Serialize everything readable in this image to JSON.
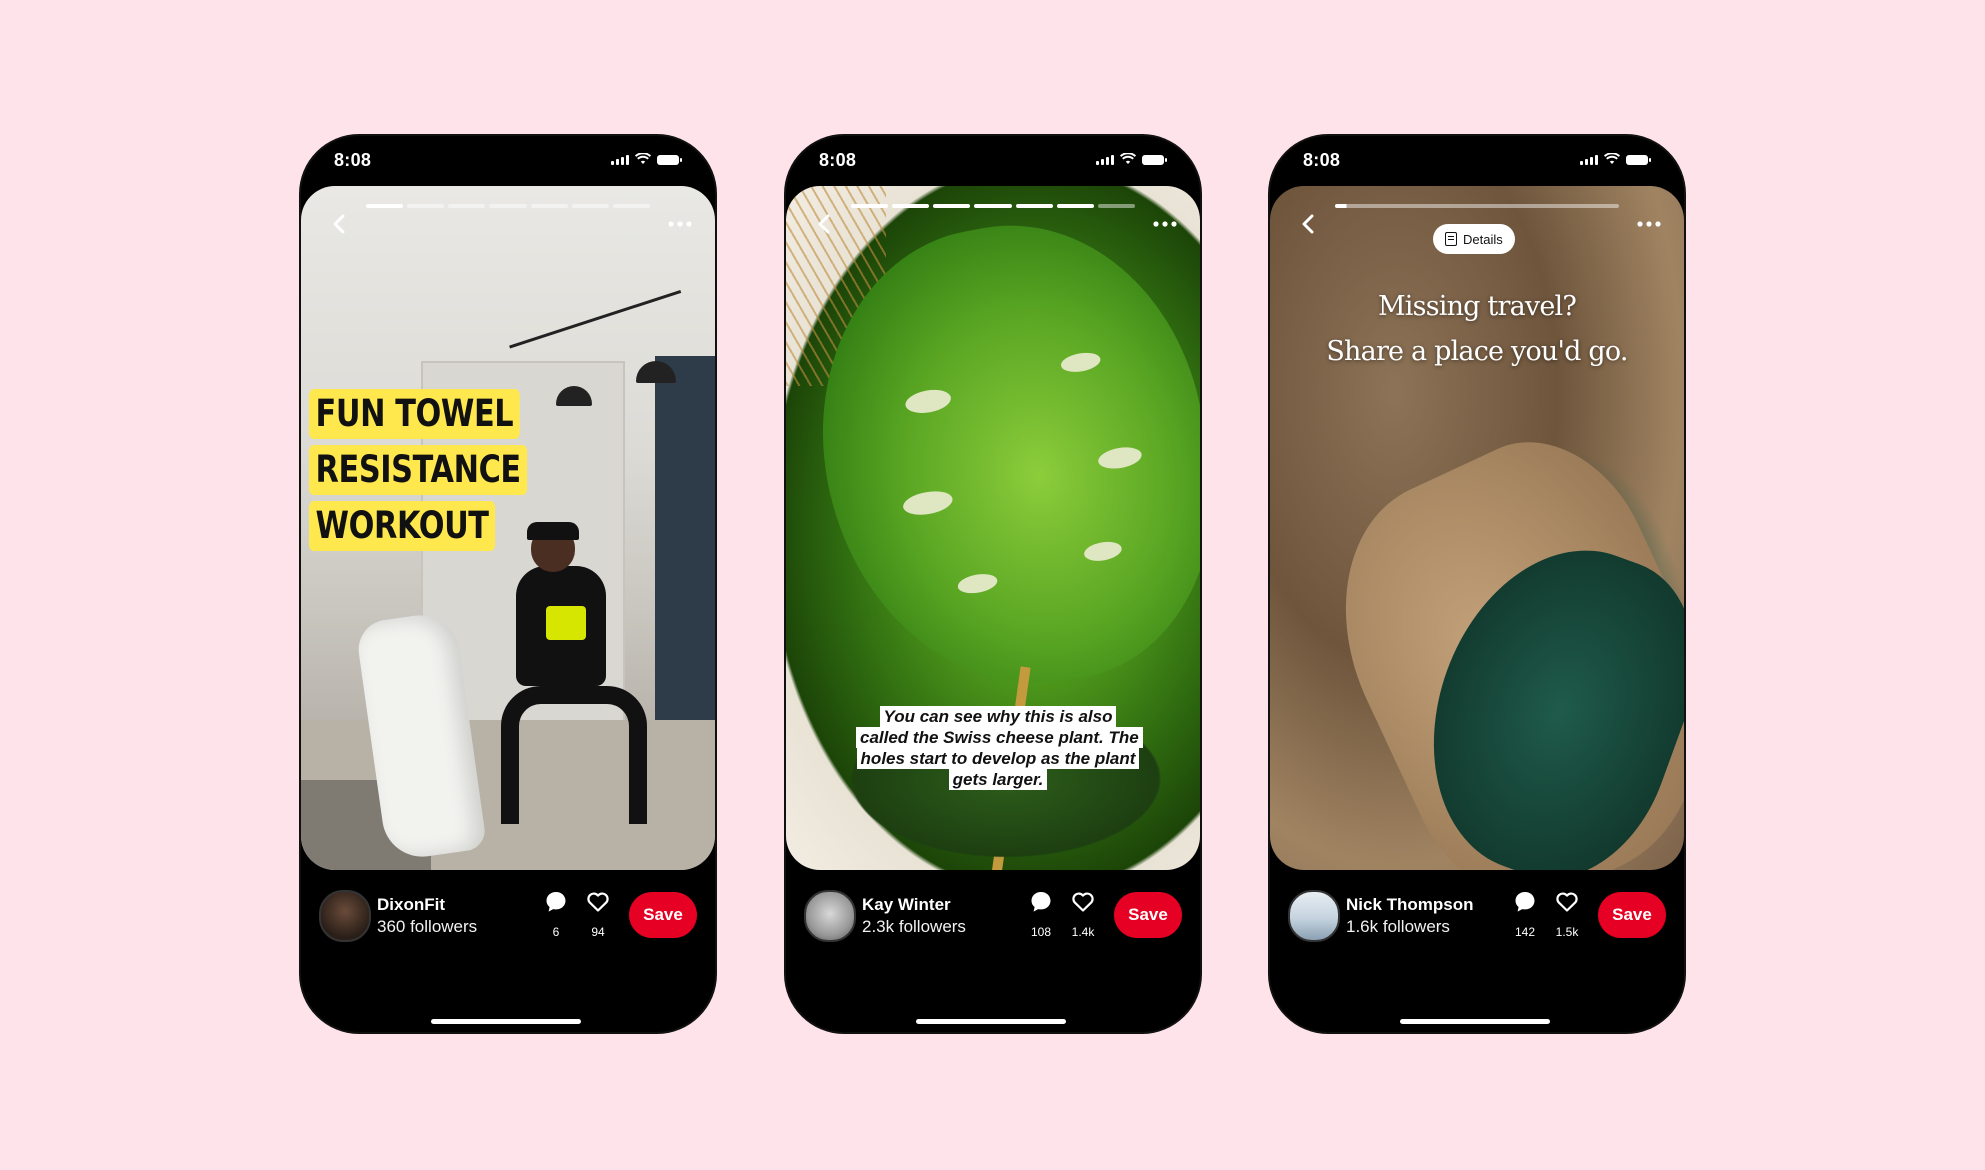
{
  "status_time": "8:08",
  "phones": [
    {
      "overlay_lines": [
        "FUN TOWEL",
        "RESISTANCE",
        "WORKOUT"
      ],
      "author_name": "DixonFit",
      "followers": "360 followers",
      "comments": "6",
      "likes": "94",
      "save_label": "Save",
      "progress_segments": 7,
      "progress_done": 1
    },
    {
      "caption": "You can see why this is also called the Swiss cheese plant. The holes start to develop as the plant gets larger.",
      "author_name": "Kay Winter",
      "followers": "2.3k followers",
      "comments": "108",
      "likes": "1.4k",
      "save_label": "Save",
      "progress_segments": 7,
      "progress_done": 6
    },
    {
      "details_label": "Details",
      "caption_lines": [
        "Missing travel?",
        "Share a place you'd go."
      ],
      "author_name": "Nick Thompson",
      "followers": "1.6k followers",
      "comments": "142",
      "likes": "1.5k",
      "save_label": "Save",
      "progress_segments": 1,
      "progress_done": 0
    }
  ],
  "colors": {
    "background": "#FFE3EA",
    "save": "#e60023",
    "overlay_yellow": "#ffe84d"
  },
  "icons": [
    "back-chevron-icon",
    "more-dots-icon",
    "comment-icon",
    "heart-icon",
    "document-icon",
    "signal-icon",
    "wifi-icon",
    "battery-icon"
  ]
}
